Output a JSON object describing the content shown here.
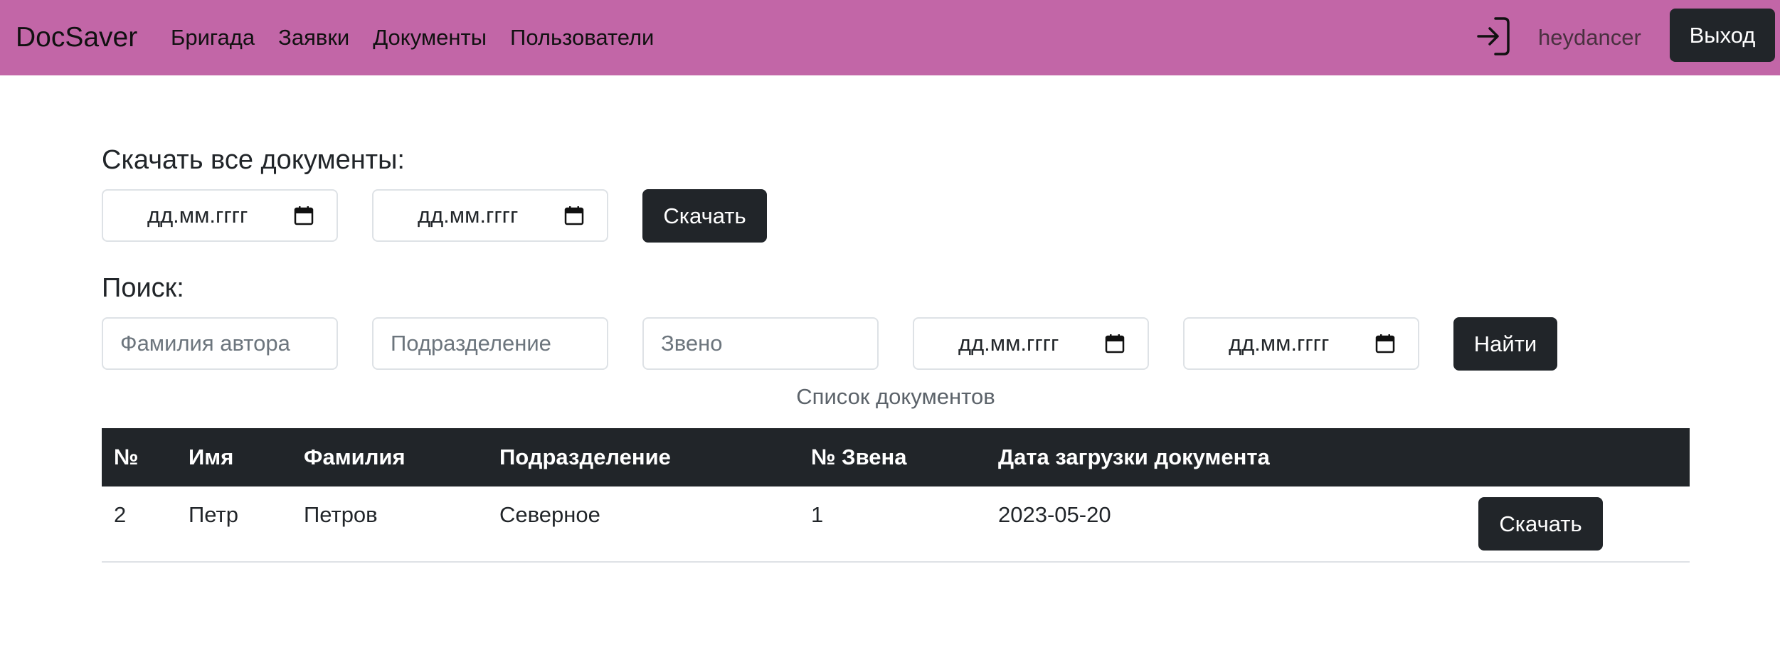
{
  "navbar": {
    "brand": "DocSaver",
    "links": [
      "Бригада",
      "Заявки",
      "Документы",
      "Пользователи"
    ],
    "username": "heydancer",
    "logout_label": "Выход",
    "background_color": "#c266a7"
  },
  "download_all": {
    "heading": "Скачать все документы:",
    "date_from": "дд.мм.гггг",
    "date_to": "дд.мм.гггг",
    "button_label": "Скачать"
  },
  "search": {
    "heading": "Поиск:",
    "author_placeholder": "Фамилия автора",
    "division_placeholder": "Подразделение",
    "unit_placeholder": "Звено",
    "date_from": "дд.мм.гггг",
    "date_to": "дд.мм.гггг",
    "button_label": "Найти"
  },
  "table": {
    "caption": "Список документов",
    "headers": [
      "№",
      "Имя",
      "Фамилия",
      "Подразделение",
      "№ Звена",
      "Дата загрузки документа"
    ],
    "rows": [
      {
        "num": "2",
        "name": "Петр",
        "surname": "Петров",
        "division": "Северное",
        "unit": "1",
        "date": "2023-05-20",
        "action_label": "Скачать"
      }
    ]
  }
}
